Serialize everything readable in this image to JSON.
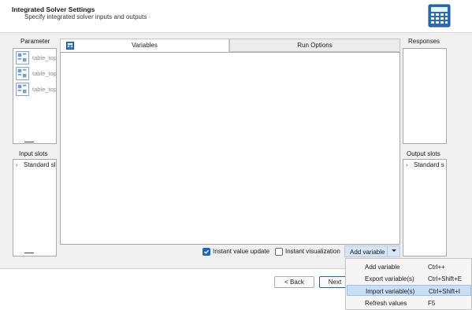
{
  "header": {
    "title": "Integrated Solver Settings",
    "subtitle": "Specify integrated solver inputs and outputs"
  },
  "parameter": {
    "title": "Parameter",
    "items": [
      {
        "label": "table_top"
      },
      {
        "label": "table_top"
      },
      {
        "label": "table_top"
      }
    ]
  },
  "input_slots": {
    "title": "Input slots",
    "items": [
      {
        "label": "Standard sl"
      }
    ]
  },
  "tabs": [
    {
      "label": "Variables",
      "active": true
    },
    {
      "label": "Run Options",
      "active": false
    }
  ],
  "responses": {
    "title": "Responses"
  },
  "output_slots": {
    "title": "Output slots",
    "items": [
      {
        "label": "Standard s"
      }
    ]
  },
  "options": {
    "instant_value_update": {
      "label": "Instant value update",
      "checked": true
    },
    "instant_visualization": {
      "label": "Instant visualization",
      "checked": false
    }
  },
  "add_variable_label": "Add variable",
  "context_menu": {
    "items": [
      {
        "label": "Add variable",
        "shortcut": "Ctrl++",
        "highlighted": false
      },
      {
        "label": "Export variable(s)",
        "shortcut": "Ctrl+Shift+E",
        "highlighted": false
      },
      {
        "label": "Import variable(s)",
        "shortcut": "Ctrl+Shift+I",
        "highlighted": true
      },
      {
        "label": "Refresh values",
        "shortcut": "F5",
        "highlighted": false
      }
    ]
  },
  "footer": {
    "back_label": "< Back",
    "next_label": "Next"
  },
  "colors": {
    "accent": "#1e64c8",
    "menu_highlight": "#c9def5"
  }
}
